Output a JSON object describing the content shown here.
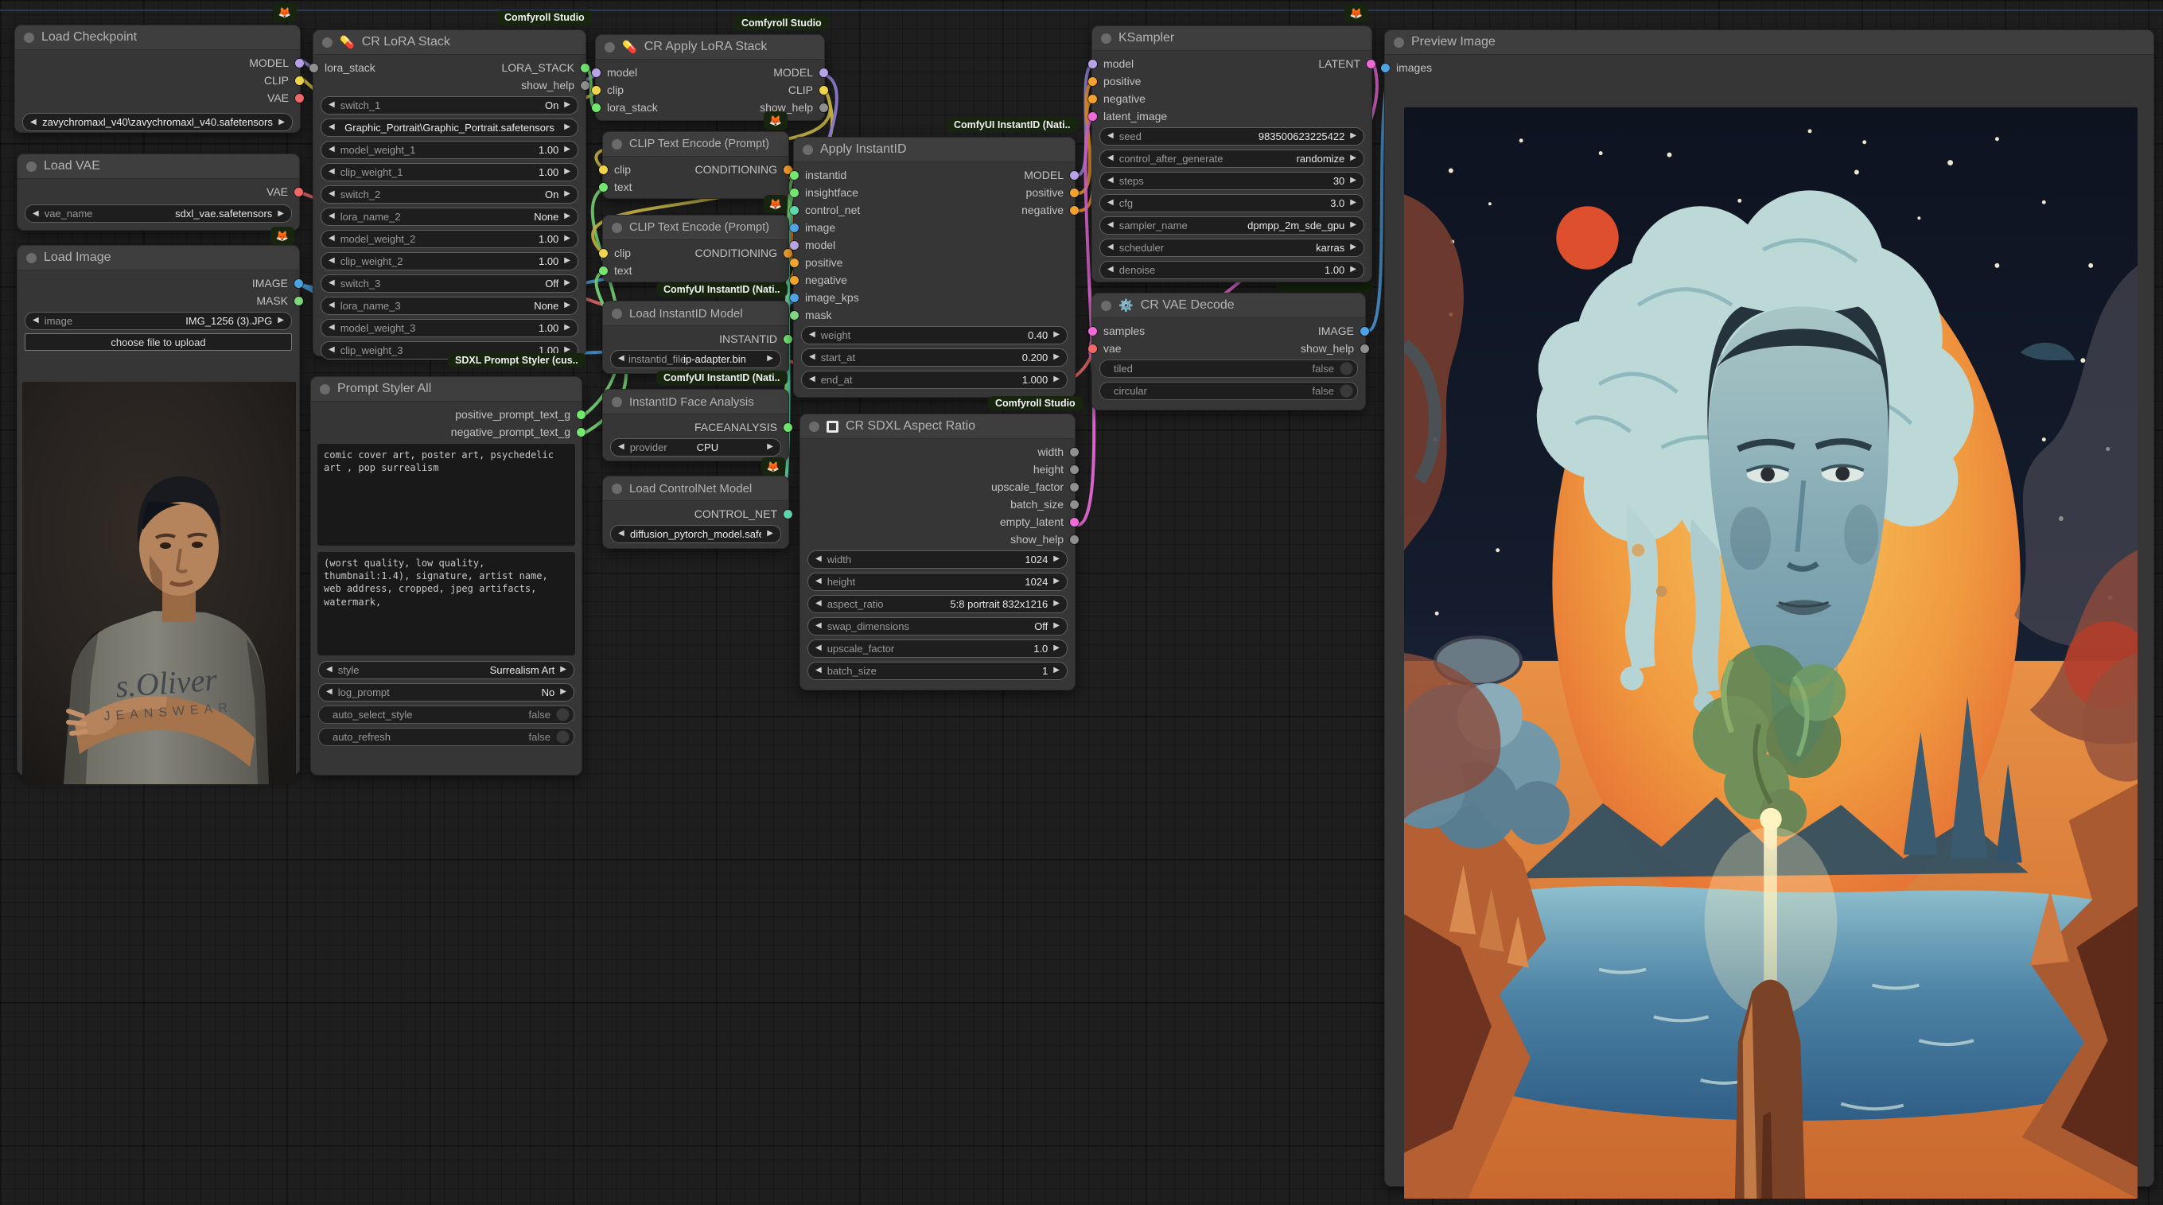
{
  "icons": {
    "left_arrow": "◀",
    "right_arrow": "▶",
    "pill": "💊",
    "gear": "⚙️",
    "fox": "🦊"
  },
  "colors": {
    "model": "#b8a3e8",
    "clip": "#f0d54c",
    "vae": "#f16a6a",
    "image": "#4fa3e3",
    "mask": "#7fd77f",
    "conditioning": "#f5a12e",
    "latent": "#f06ad8",
    "generic_green": "#72e66f",
    "control_net": "#5fd8b0",
    "gray_slot": "#8f8f8f",
    "badge_bg": "#17250f"
  },
  "badges": {
    "comfyroll": "Comfyroll Studio",
    "styler": "SDXL Prompt Styler (cus..",
    "instantid": "ComfyUI InstantID (Nati.."
  },
  "nodes": {
    "load_checkpoint": {
      "title": "Load Checkpoint",
      "outputs": [
        "MODEL",
        "CLIP",
        "VAE"
      ],
      "widgets": [
        {
          "value": "zavychromaxl_v40\\zavychromaxl_v40.safetensors"
        }
      ]
    },
    "load_vae": {
      "title": "Load VAE",
      "outputs": [
        "VAE"
      ],
      "widgets": [
        {
          "label": "vae_name",
          "value": "sdxl_vae.safetensors"
        }
      ]
    },
    "load_image": {
      "title": "Load Image",
      "outputs": [
        "IMAGE",
        "MASK"
      ],
      "widgets": [
        {
          "label": "image",
          "value": "IMG_1256 (3).JPG"
        }
      ],
      "upload_label": "choose file to upload"
    },
    "cr_lora_stack": {
      "title": "CR LoRA Stack",
      "inputs": [
        "lora_stack"
      ],
      "outputs": [
        "LORA_STACK",
        "show_help"
      ],
      "widgets": [
        {
          "label": "switch_1",
          "value": "On"
        },
        {
          "value": "Graphic_Portrait\\Graphic_Portrait.safetensors"
        },
        {
          "label": "model_weight_1",
          "value": "1.00"
        },
        {
          "label": "clip_weight_1",
          "value": "1.00"
        },
        {
          "label": "switch_2",
          "value": "On"
        },
        {
          "label": "lora_name_2",
          "value": "None"
        },
        {
          "label": "model_weight_2",
          "value": "1.00"
        },
        {
          "label": "clip_weight_2",
          "value": "1.00"
        },
        {
          "label": "switch_3",
          "value": "Off"
        },
        {
          "label": "lora_name_3",
          "value": "None"
        },
        {
          "label": "model_weight_3",
          "value": "1.00"
        },
        {
          "label": "clip_weight_3",
          "value": "1.00"
        }
      ]
    },
    "prompt_styler": {
      "title": "Prompt Styler All",
      "outputs": [
        "positive_prompt_text_g",
        "negative_prompt_text_g"
      ],
      "positive_text": "comic cover art, poster art, psychedelic art , pop surrealism",
      "negative_text": "(worst quality, low quality, thumbnail:1.4), signature, artist name, web address, cropped, jpeg artifacts, watermark,",
      "widgets": [
        {
          "label": "style",
          "value": "Surrealism Art"
        },
        {
          "label": "log_prompt",
          "value": "No"
        }
      ],
      "toggles": [
        {
          "label": "auto_select_style",
          "value": "false"
        },
        {
          "label": "auto_refresh",
          "value": "false"
        }
      ]
    },
    "cr_apply_lora": {
      "title": "CR Apply LoRA Stack",
      "inputs": [
        "model",
        "clip",
        "lora_stack"
      ],
      "outputs": [
        "MODEL",
        "CLIP",
        "show_help"
      ]
    },
    "clip_encode_1": {
      "title": "CLIP Text Encode (Prompt)",
      "inputs": [
        "clip",
        "text"
      ],
      "outputs": [
        "CONDITIONING"
      ]
    },
    "clip_encode_2": {
      "title": "CLIP Text Encode (Prompt)",
      "inputs": [
        "clip",
        "text"
      ],
      "outputs": [
        "CONDITIONING"
      ]
    },
    "load_instantid": {
      "title": "Load InstantID Model",
      "outputs": [
        "INSTANTID"
      ],
      "widgets": [
        {
          "label": "instantid_file",
          "value": "ip-adapter.bin"
        }
      ]
    },
    "face_analysis": {
      "title": "InstantID Face Analysis",
      "outputs": [
        "FACEANALYSIS"
      ],
      "widgets": [
        {
          "label": "provider",
          "value": "CPU"
        }
      ]
    },
    "load_controlnet": {
      "title": "Load ControlNet Model",
      "outputs": [
        "CONTROL_NET"
      ],
      "widgets": [
        {
          "value": "diffusion_pytorch_model.safetensors"
        }
      ]
    },
    "apply_instantid": {
      "title": "Apply InstantID",
      "inputs": [
        "instantid",
        "insightface",
        "control_net",
        "image",
        "model",
        "positive",
        "negative",
        "image_kps",
        "mask"
      ],
      "outputs": [
        "MODEL",
        "positive",
        "negative"
      ],
      "widgets": [
        {
          "label": "weight",
          "value": "0.40"
        },
        {
          "label": "start_at",
          "value": "0.200"
        },
        {
          "label": "end_at",
          "value": "1.000"
        }
      ]
    },
    "aspect_ratio": {
      "title": "CR SDXL Aspect Ratio",
      "outputs": [
        "width",
        "height",
        "upscale_factor",
        "batch_size",
        "empty_latent",
        "show_help"
      ],
      "widgets": [
        {
          "label": "width",
          "value": "1024"
        },
        {
          "label": "height",
          "value": "1024"
        },
        {
          "label": "aspect_ratio",
          "value": "5:8 portrait 832x1216"
        },
        {
          "label": "swap_dimensions",
          "value": "Off"
        },
        {
          "label": "upscale_factor",
          "value": "1.0"
        },
        {
          "label": "batch_size",
          "value": "1"
        }
      ]
    },
    "ksampler": {
      "title": "KSampler",
      "inputs": [
        "model",
        "positive",
        "negative",
        "latent_image"
      ],
      "outputs": [
        "LATENT"
      ],
      "widgets": [
        {
          "label": "seed",
          "value": "983500623225422"
        },
        {
          "label": "control_after_generate",
          "value": "randomize"
        },
        {
          "label": "steps",
          "value": "30"
        },
        {
          "label": "cfg",
          "value": "3.0"
        },
        {
          "label": "sampler_name",
          "value": "dpmpp_2m_sde_gpu"
        },
        {
          "label": "scheduler",
          "value": "karras"
        },
        {
          "label": "denoise",
          "value": "1.00"
        }
      ]
    },
    "cr_vae_decode": {
      "title": "CR VAE Decode",
      "inputs": [
        "samples",
        "vae"
      ],
      "outputs": [
        "IMAGE",
        "show_help"
      ],
      "toggles": [
        {
          "label": "tiled",
          "value": "false"
        },
        {
          "label": "circular",
          "value": "false"
        }
      ]
    },
    "preview": {
      "title": "Preview Image",
      "inputs": [
        "images"
      ]
    }
  }
}
